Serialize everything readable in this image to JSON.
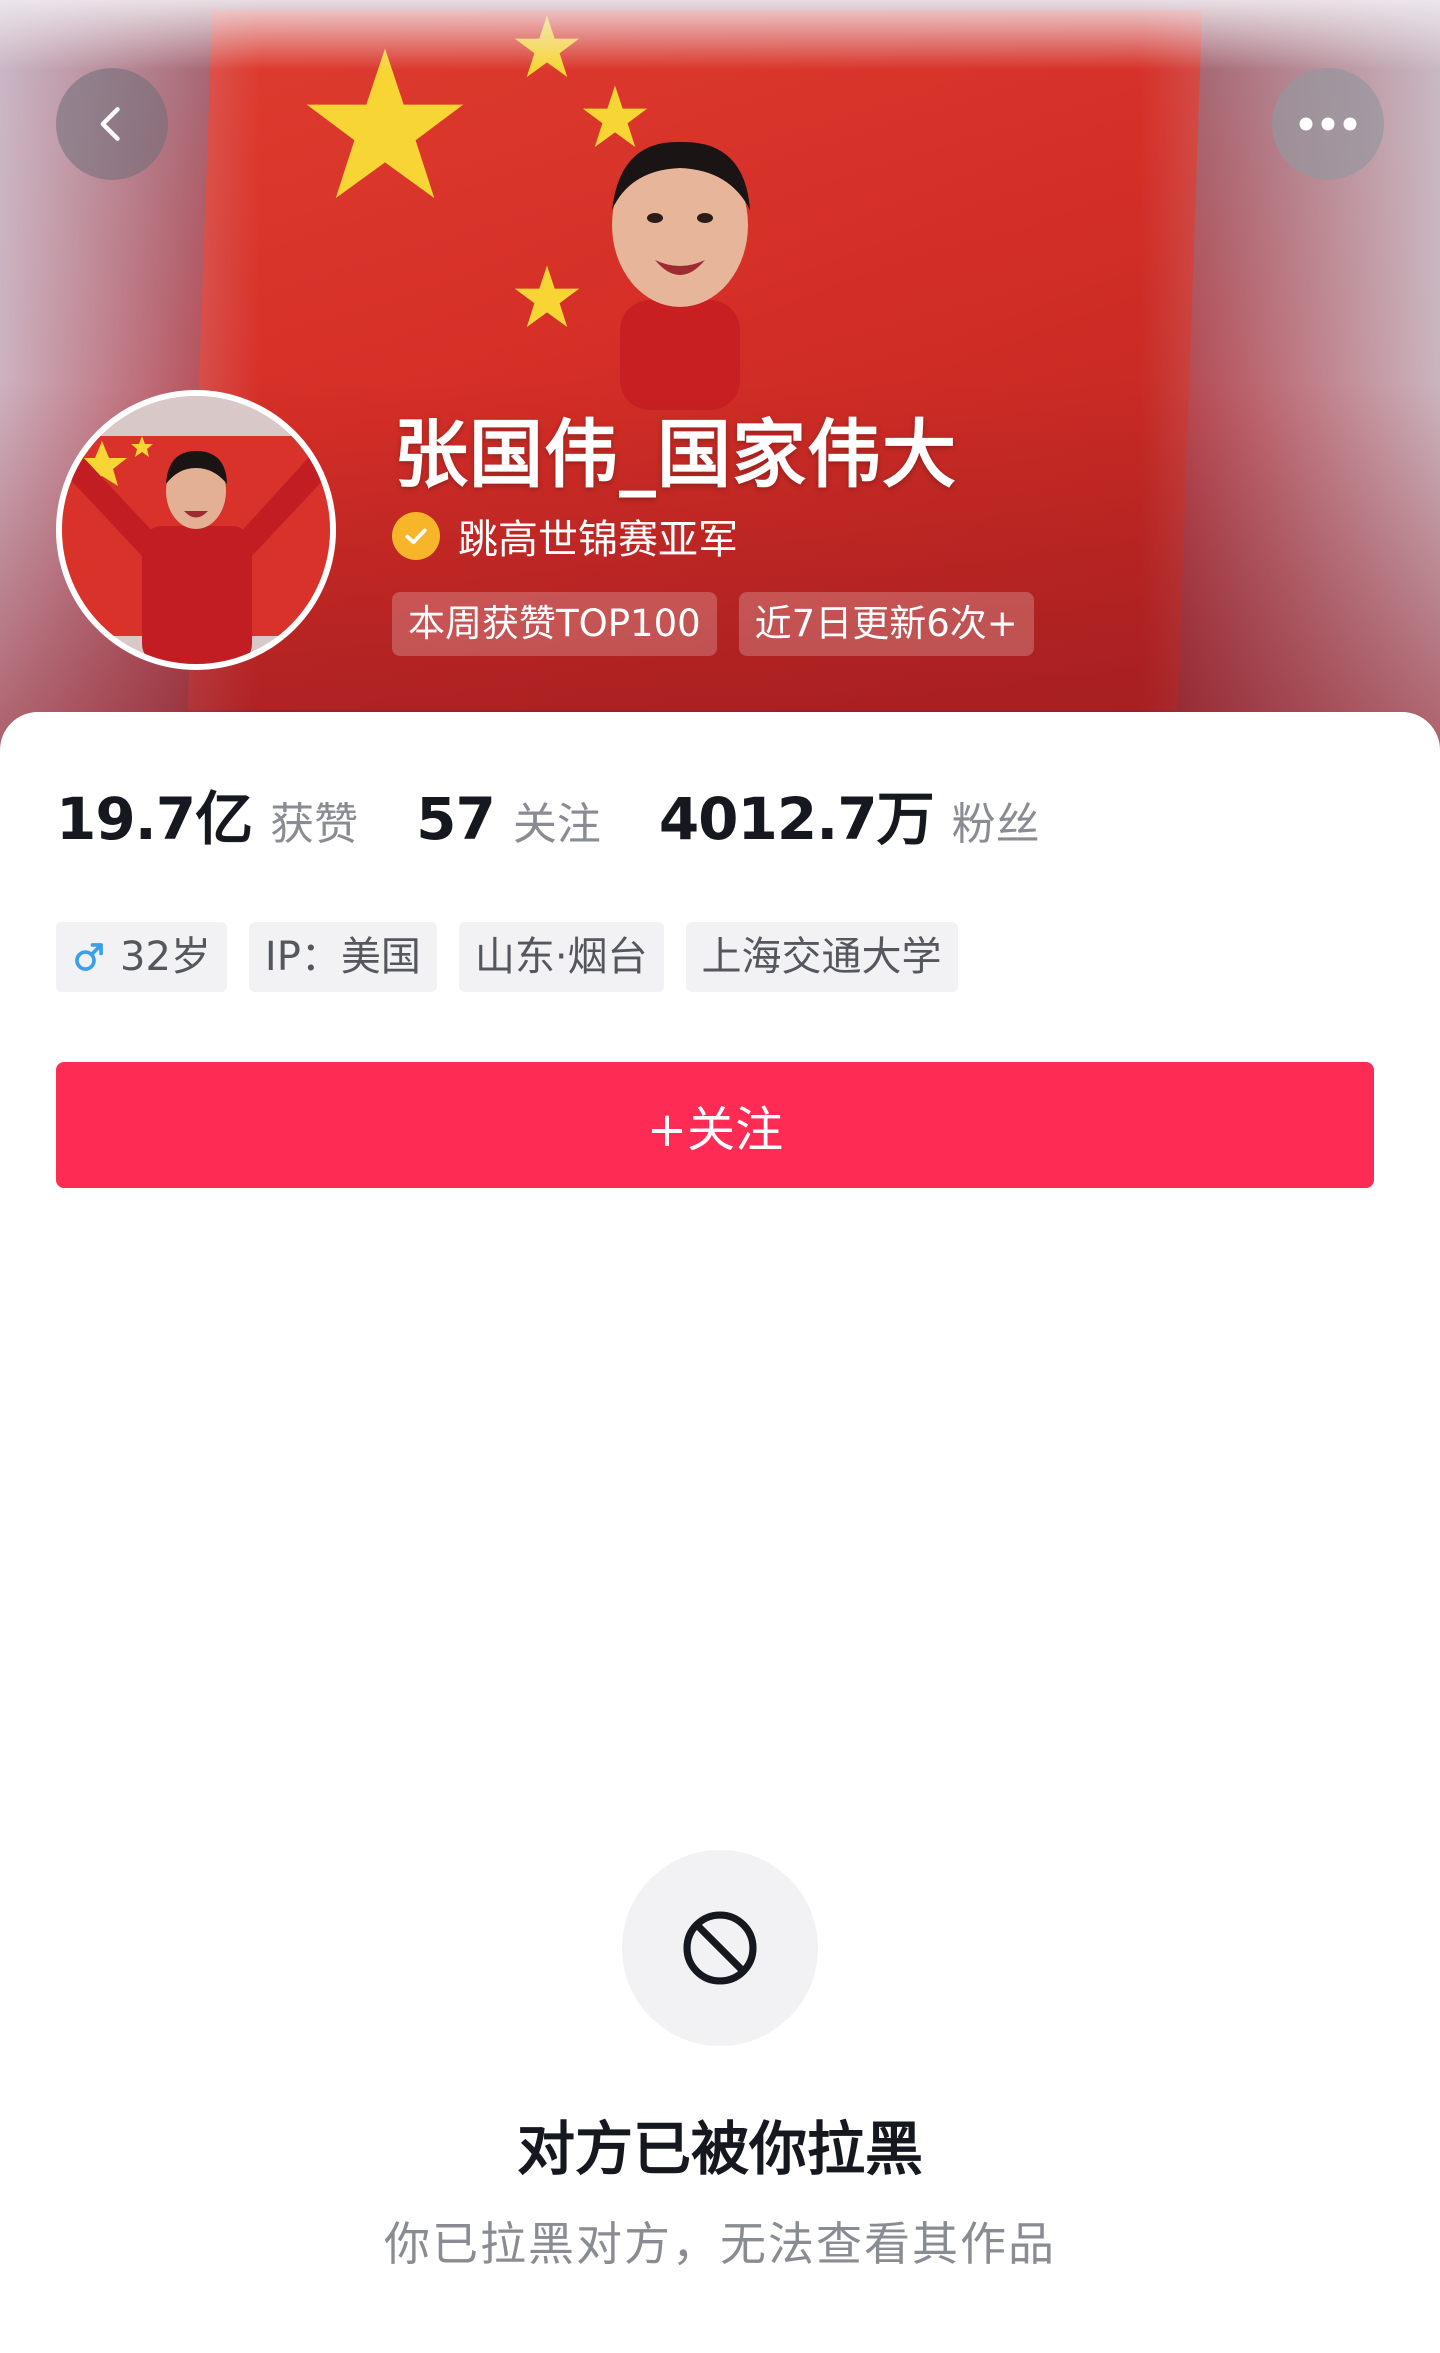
{
  "header": {
    "back_icon": "chevron-left-icon",
    "more_icon": "more-horizontal-icon",
    "name": "张国伟_国家伟大",
    "verified_title": "跳高世锦赛亚军",
    "badges": [
      "本周获赞TOP100",
      "近7日更新6次+"
    ]
  },
  "stats": [
    {
      "value": "19.7亿",
      "label": "获赞"
    },
    {
      "value": "57",
      "label": "关注"
    },
    {
      "value": "4012.7万",
      "label": "粉丝"
    }
  ],
  "info_tags": {
    "age": "32岁",
    "ip": "IP：美国",
    "location": "山东·烟台",
    "school": "上海交通大学"
  },
  "follow_label": "+关注",
  "blocked": {
    "icon": "block-icon",
    "title": "对方已被你拉黑",
    "desc": "你已拉黑对方，无法查看其作品"
  },
  "colors": {
    "accent": "#fe2c55",
    "verify": "#f7b62a",
    "male": "#3aa0e8"
  }
}
